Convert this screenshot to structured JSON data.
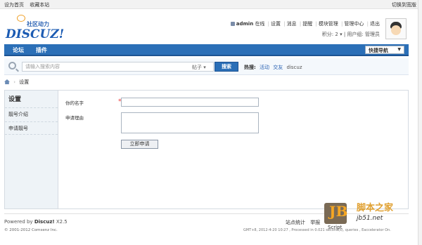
{
  "topbar": {
    "set_home": "设为首页",
    "bookmark": "收藏本站",
    "switch_style": "切换到宽版"
  },
  "logo": {
    "tagline": "社区动力",
    "word": "DISCUZ!"
  },
  "user_nav": {
    "username": "admin",
    "status": "在线",
    "items": [
      "设置",
      "消息",
      "提醒",
      "模块管理",
      "管理中心",
      "退出"
    ],
    "points": "积分: 2",
    "group": "用户组: 管理员"
  },
  "nav": {
    "items": [
      "论坛",
      "插件"
    ],
    "quick": "快捷导航"
  },
  "search": {
    "placeholder": "请输入搜索内容",
    "scope": "帖子 ▾",
    "button": "搜索",
    "hot_label": "热搜:",
    "hot_items": [
      "活动",
      "交友",
      "discuz"
    ]
  },
  "breadcrumb": {
    "current": "设置"
  },
  "sidebar": {
    "title": "设置",
    "items": [
      "靓号介绍",
      "申请靓号"
    ]
  },
  "form": {
    "name_label": "你的名字",
    "reason_label": "申请理由",
    "submit": "立即申请"
  },
  "footer": {
    "powered_prefix": "Powered by",
    "powered_name": "Discuz!",
    "version": "X2.5",
    "copyright": "© 2001-2012 Comsenz Inc.",
    "links": [
      "站点统计",
      "举报"
    ],
    "stat": "GMT+8, 2012-4-20 10:27 , Processed in 0.021 second(s), queries , Eaccelerator On."
  },
  "watermark": {
    "j": "JB",
    "cn": "脚本之家",
    "domain": "jb51.net",
    "script": "Script"
  }
}
